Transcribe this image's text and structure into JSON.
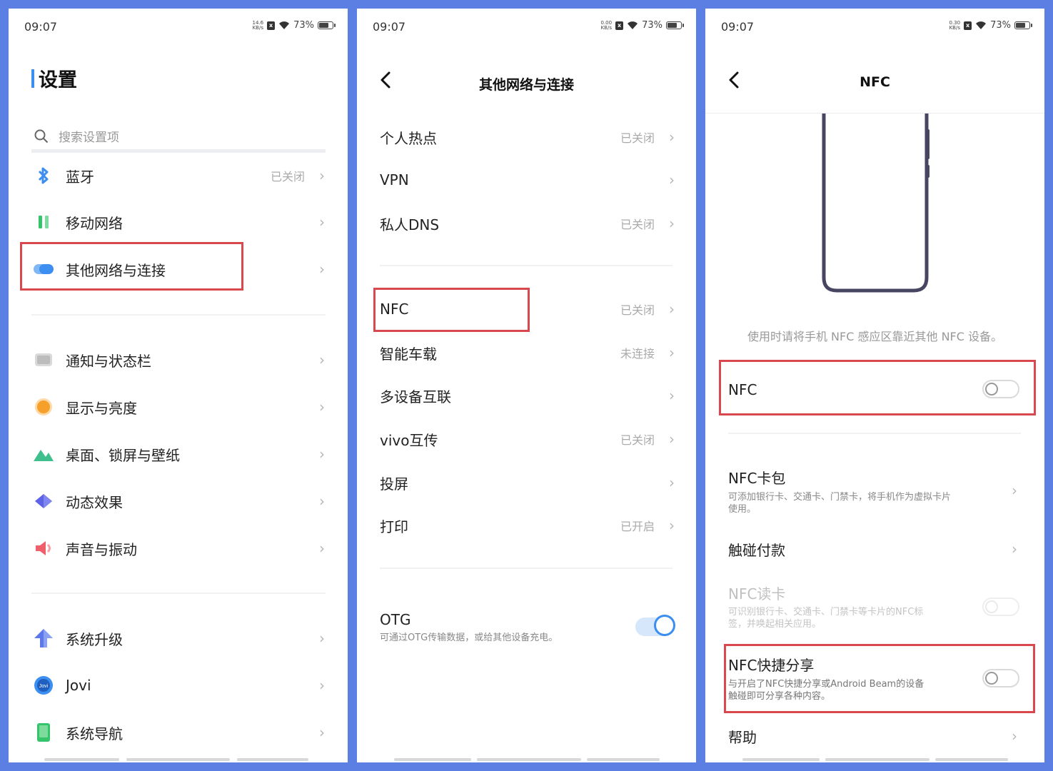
{
  "panel1": {
    "status": {
      "time": "09:07",
      "speed_top": "14.6",
      "speed_bottom": "KB/s",
      "battery": "73%"
    },
    "title": "设置",
    "search_placeholder": "搜索设置项",
    "items": [
      {
        "label": "蓝牙",
        "value": "已关闭",
        "icon": "bluetooth-icon",
        "color": "#3c8ef0"
      },
      {
        "label": "移动网络",
        "value": "",
        "icon": "mobile-network-icon",
        "color": "#34c46a"
      },
      {
        "label": "其他网络与连接",
        "value": "",
        "icon": "other-connections-icon",
        "color": "#3c8ef0"
      },
      {
        "label": "通知与状态栏",
        "value": "",
        "icon": "notification-icon",
        "color": "#c8c8c8"
      },
      {
        "label": "显示与亮度",
        "value": "",
        "icon": "display-icon",
        "color": "#f5a02a"
      },
      {
        "label": "桌面、锁屏与壁纸",
        "value": "",
        "icon": "wallpaper-icon",
        "color": "#3fbf8e"
      },
      {
        "label": "动态效果",
        "value": "",
        "icon": "dynamic-effects-icon",
        "color": "#5d63e6"
      },
      {
        "label": "声音与振动",
        "value": "",
        "icon": "sound-icon",
        "color": "#f0606a"
      },
      {
        "label": "系统升级",
        "value": "",
        "icon": "system-upgrade-icon",
        "color": "#5d78ea"
      },
      {
        "label": "Jovi",
        "value": "",
        "icon": "jovi-icon",
        "color": "#3c8ef0"
      },
      {
        "label": "系统导航",
        "value": "",
        "icon": "system-nav-icon",
        "color": "#34c46a"
      }
    ]
  },
  "panel2": {
    "status": {
      "time": "09:07",
      "speed_top": "0.00",
      "speed_bottom": "KB/s",
      "battery": "73%"
    },
    "title": "其他网络与连接",
    "items": [
      {
        "label": "个人热点",
        "value": "已关闭"
      },
      {
        "label": "VPN",
        "value": ""
      },
      {
        "label": "私人DNS",
        "value": "已关闭"
      },
      {
        "label": "NFC",
        "value": "已关闭"
      },
      {
        "label": "智能车载",
        "value": "未连接"
      },
      {
        "label": "多设备互联",
        "value": ""
      },
      {
        "label": "vivo互传",
        "value": "已关闭"
      },
      {
        "label": "投屏",
        "value": ""
      },
      {
        "label": "打印",
        "value": "已开启"
      }
    ],
    "otg": {
      "label": "OTG",
      "desc": "可通过OTG传输数据，或给其他设备充电。",
      "on": true
    }
  },
  "panel3": {
    "status": {
      "time": "09:07",
      "speed_top": "0.30",
      "speed_bottom": "KB/s",
      "battery": "73%"
    },
    "title": "NFC",
    "hint": "使用时请将手机 NFC 感应区靠近其他 NFC 设备。",
    "nfc_toggle": {
      "label": "NFC",
      "on": false
    },
    "wallet": {
      "label": "NFC卡包",
      "desc_line1": "可添加银行卡、交通卡、门禁卡，将手机作为虚拟卡片",
      "desc_line2": "使用。"
    },
    "tap_pay": {
      "label": "触碰付款"
    },
    "card_reader": {
      "label": "NFC读卡",
      "desc_line1": "可识别银行卡、交通卡、门禁卡等卡片的NFC标",
      "desc_line2": "签，并唤起相关应用。"
    },
    "quick_share": {
      "label": "NFC快捷分享",
      "desc_line1": "与开启了NFC快捷分享或Android Beam的设备",
      "desc_line2": "触碰即可分享各种内容。"
    },
    "help": {
      "label": "帮助"
    }
  },
  "chevron": "›"
}
